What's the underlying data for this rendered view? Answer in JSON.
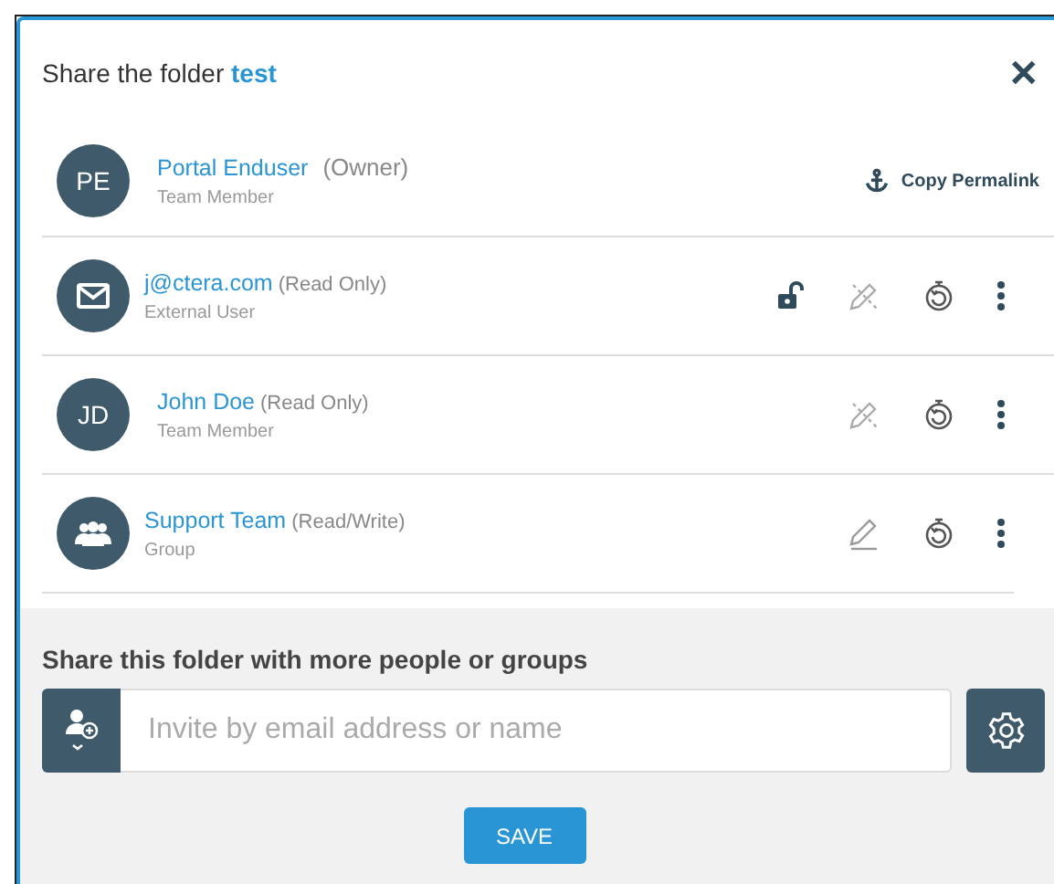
{
  "dialog": {
    "title": "Share the folder",
    "folder_name": "test",
    "close": "✕"
  },
  "owner": {
    "initials": "PE",
    "name": "Portal Enduser",
    "role": "(Owner)",
    "type": "Team Member",
    "action": "Copy Permalink"
  },
  "members": [
    {
      "kind": "email",
      "name": "j@ctera.com",
      "role": "(Read Only)",
      "type": "External User",
      "lock": true,
      "can_edit": false
    },
    {
      "kind": "initials",
      "initials": "JD",
      "name": "John Doe",
      "role": "(Read Only)",
      "type": "Team Member",
      "lock": false,
      "can_edit": false
    },
    {
      "kind": "group",
      "name": "Support Team",
      "role": "(Read/Write)",
      "type": "Group",
      "lock": false,
      "can_edit": true
    }
  ],
  "share": {
    "heading": "Share this folder with more people or groups",
    "placeholder": "Invite by email address or name",
    "save": "SAVE"
  }
}
